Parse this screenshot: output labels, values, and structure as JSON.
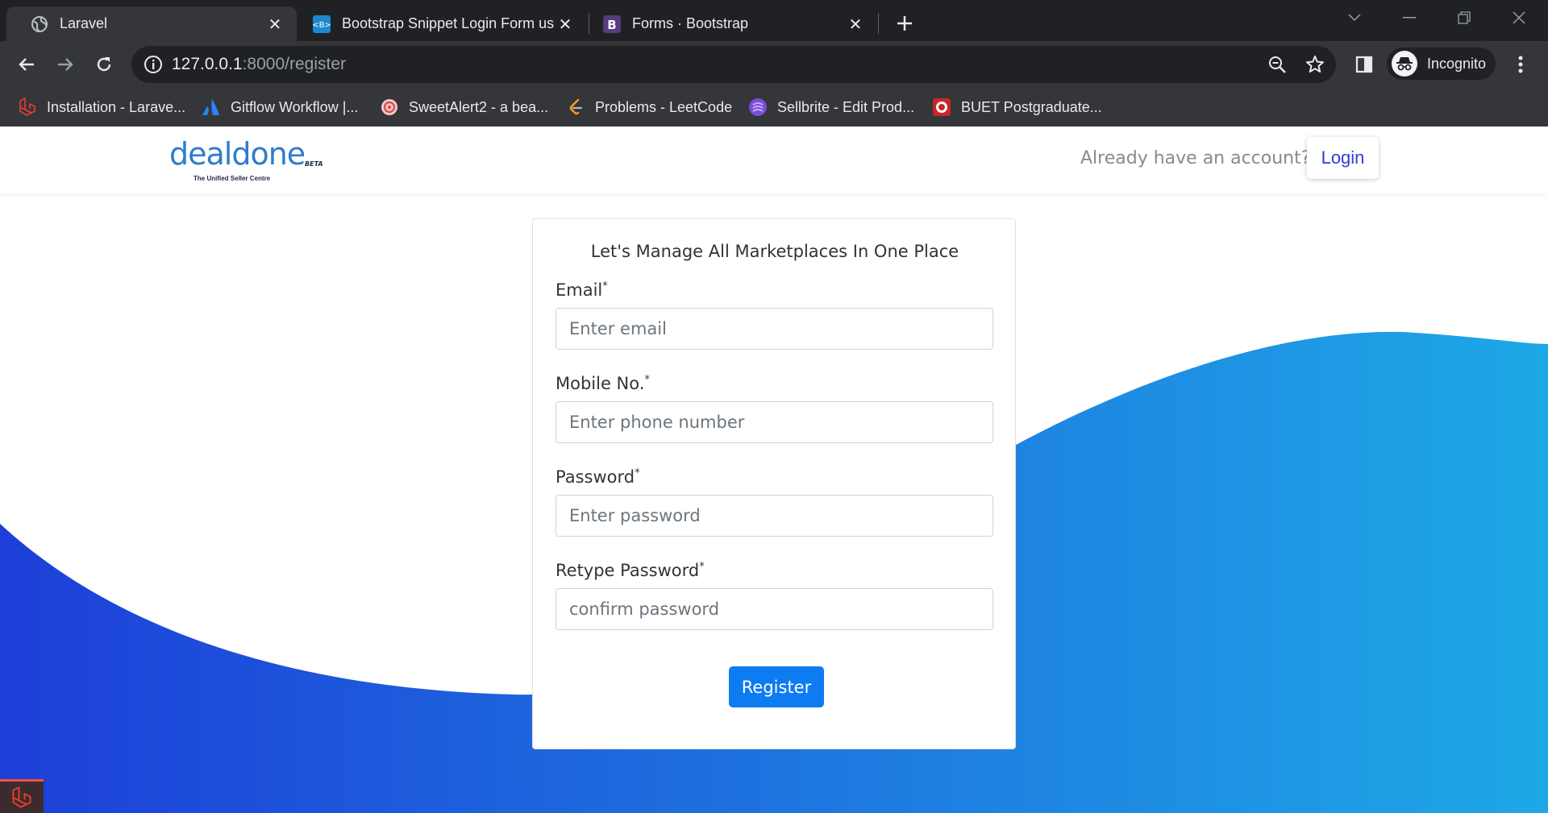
{
  "browser": {
    "tabs": [
      {
        "title": "Laravel",
        "icon": "globe-icon"
      },
      {
        "title": "Bootstrap Snippet Login Form us",
        "icon": "bootsnipp-icon"
      },
      {
        "title": "Forms · Bootstrap",
        "icon": "bootstrap-icon"
      }
    ],
    "url_host": "127.0.0.1",
    "url_path": ":8000/register",
    "incognito_label": "Incognito",
    "bookmarks": [
      {
        "title": "Installation - Larave...",
        "icon": "laravel-icon"
      },
      {
        "title": "Gitflow Workflow |...",
        "icon": "atlassian-icon"
      },
      {
        "title": "SweetAlert2 - a bea...",
        "icon": "sweetalert-icon"
      },
      {
        "title": "Problems - LeetCode",
        "icon": "leetcode-icon"
      },
      {
        "title": "Sellbrite - Edit Prod...",
        "icon": "sellbrite-icon"
      },
      {
        "title": "BUET Postgraduate...",
        "icon": "buet-icon"
      }
    ]
  },
  "header": {
    "logo_text": "dealdone",
    "logo_badge": "BETA",
    "logo_tagline": "The Unified Seller Centre",
    "account_prompt": "Already have an account?",
    "login_label": "Login"
  },
  "form": {
    "title": "Let's Manage All Marketplaces In One Place",
    "fields": [
      {
        "label": "Email",
        "required_mark": "*",
        "placeholder": "Enter email"
      },
      {
        "label": "Mobile No.",
        "required_mark": "*",
        "placeholder": "Enter phone number"
      },
      {
        "label": "Password",
        "required_mark": "*",
        "placeholder": "Enter password"
      },
      {
        "label": "Retype Password",
        "required_mark": "*",
        "placeholder": "confirm password"
      }
    ],
    "submit_label": "Register"
  },
  "colors": {
    "wave_start": "#1d3fd8",
    "wave_end": "#1ea8e6",
    "primary_button": "#0d7bf2",
    "login_text": "#2b3fd3"
  }
}
